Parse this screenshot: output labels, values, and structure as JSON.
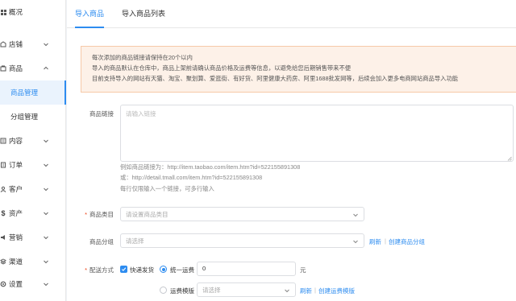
{
  "sidebar": {
    "items": [
      {
        "label": "概况",
        "icon": "grid-icon"
      },
      {
        "label": "店铺",
        "icon": "store-icon"
      },
      {
        "label": "商品",
        "icon": "goods-icon"
      },
      {
        "label": "内容",
        "icon": "content-icon"
      },
      {
        "label": "订单",
        "icon": "order-icon"
      },
      {
        "label": "客户",
        "icon": "customer-icon"
      },
      {
        "label": "资产",
        "icon": "dollar-icon"
      },
      {
        "label": "营销",
        "icon": "marketing-icon"
      },
      {
        "label": "渠道",
        "icon": "channel-icon"
      },
      {
        "label": "设置",
        "icon": "gear-icon"
      }
    ],
    "sub_items": [
      {
        "label": "商品管理",
        "active": true
      },
      {
        "label": "分组管理",
        "active": false
      }
    ]
  },
  "tabs": [
    {
      "label": "导入商品",
      "active": true
    },
    {
      "label": "导入商品列表",
      "active": false
    }
  ],
  "notice": {
    "lines": [
      "每次添加的商品链接请保持在20个以内",
      "导入的商品默认在仓库中，商品上架前请确认商品价格及运费等信息，以避免给您后期销售带来不便",
      "目前支持导入的网站有天猫、淘宝、聚划算、爱逛街、有好货、阿里健康大药房、阿里1688批发网等，后续会加入更多电商网站商品导入功能"
    ]
  },
  "form": {
    "link": {
      "label": "商品链接",
      "placeholder": "请输入链接",
      "hints": [
        "例如商品链接为：http://item.taobao.com/item.htm?id=522155891308",
        "或：http://detail.tmall.com/item.htm?id=522155891308",
        "每行仅限输入一个链接，可多行输入"
      ]
    },
    "category": {
      "label": "商品类目",
      "placeholder": "请设置商品类目",
      "required": true
    },
    "group": {
      "label": "商品分组",
      "placeholder": "请选择",
      "refresh": "刷新",
      "separator": "|",
      "create": "创建商品分组"
    },
    "shipping": {
      "label": "配送方式",
      "required": true,
      "express_label": "快递发货",
      "express_checked": true,
      "uniform_label": "统一运费",
      "uniform_value": "0",
      "unit": "元",
      "template_label": "运费模版",
      "template_placeholder": "请选择",
      "refresh": "刷新",
      "separator": "|",
      "create": "创建运费模版"
    }
  },
  "colors": {
    "accent": "#2d8cf0",
    "notice_bg": "#fdf1e8",
    "notice_border": "#f6c9a8",
    "required": "#ed4014"
  }
}
